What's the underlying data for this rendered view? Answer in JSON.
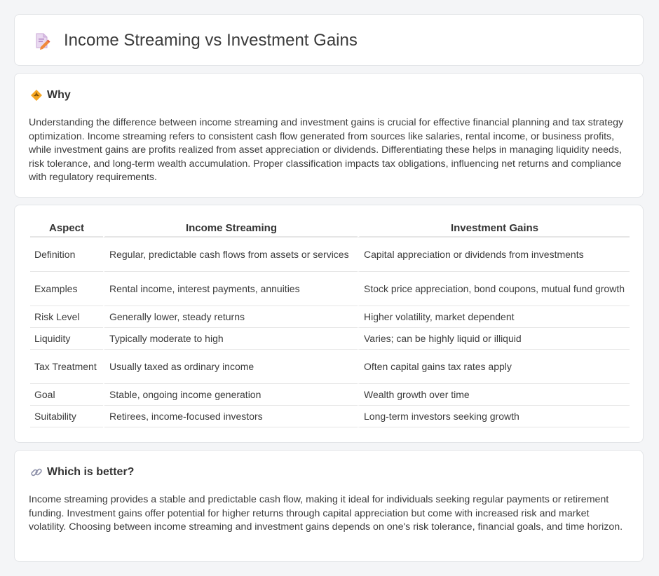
{
  "header": {
    "title": "Income Streaming vs Investment Gains",
    "icon": "document-edit-icon"
  },
  "why": {
    "heading": "Why",
    "icon": "diamond-warning-icon",
    "text": "Understanding the difference between income streaming and investment gains is crucial for effective financial planning and tax strategy optimization. Income streaming refers to consistent cash flow generated from sources like salaries, rental income, or business profits, while investment gains are profits realized from asset appreciation or dividends. Differentiating these helps in managing liquidity needs, risk tolerance, and long-term wealth accumulation. Proper classification impacts tax obligations, influencing net returns and compliance with regulatory requirements."
  },
  "table": {
    "headers": [
      "Aspect",
      "Income Streaming",
      "Investment Gains"
    ],
    "rows": [
      [
        "Definition",
        "Regular, predictable cash flows from assets or services",
        "Capital appreciation or dividends from investments"
      ],
      [
        "Examples",
        "Rental income, interest payments, annuities",
        "Stock price appreciation, bond coupons, mutual fund growth"
      ],
      [
        "Risk Level",
        "Generally lower, steady returns",
        "Higher volatility, market dependent"
      ],
      [
        "Liquidity",
        "Typically moderate to high",
        "Varies; can be highly liquid or illiquid"
      ],
      [
        "Tax Treatment",
        "Usually taxed as ordinary income",
        "Often capital gains tax rates apply"
      ],
      [
        "Goal",
        "Stable, ongoing income generation",
        "Wealth growth over time"
      ],
      [
        "Suitability",
        "Retirees, income-focused investors",
        "Long-term investors seeking growth"
      ]
    ]
  },
  "better": {
    "heading": "Which is better?",
    "icon": "link-icon",
    "text": "Income streaming provides a stable and predictable cash flow, making it ideal for individuals seeking regular payments or retirement funding. Investment gains offer potential for higher returns through capital appreciation but come with increased risk and market volatility. Choosing between income streaming and investment gains depends on one's risk tolerance, financial goals, and time horizon."
  }
}
